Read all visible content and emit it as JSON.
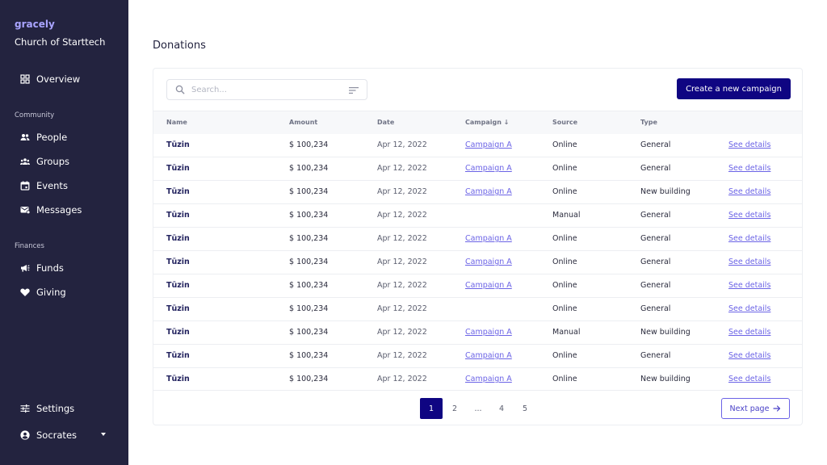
{
  "sidebar": {
    "brand": "gracely",
    "org": "Church of Starttech",
    "overview": {
      "label": "Overview",
      "icon": "grid-icon"
    },
    "community_label": "Community",
    "community": [
      {
        "label": "People",
        "icon": "people-icon"
      },
      {
        "label": "Groups",
        "icon": "groups-icon"
      },
      {
        "label": "Events",
        "icon": "calendar-icon"
      },
      {
        "label": "Messages",
        "icon": "messages-icon"
      }
    ],
    "finances_label": "Finances",
    "finances": [
      {
        "label": "Funds",
        "icon": "megaphone-icon"
      },
      {
        "label": "Giving",
        "icon": "heart-icon"
      }
    ],
    "settings": {
      "label": "Settings",
      "icon": "sliders-icon"
    },
    "user": {
      "label": "Socrates",
      "icon": "user-circle-icon"
    }
  },
  "page": {
    "title": "Donations"
  },
  "toolbar": {
    "search_placeholder": "Search...",
    "create_label": "Create a new campaign"
  },
  "table": {
    "headers": {
      "name": "Name",
      "amount": "Amount",
      "date": "Date",
      "campaign": "Campaign ↓",
      "source": "Source",
      "type": "Type"
    },
    "rows": [
      {
        "name": "Tūzin",
        "amount": "$ 100,234",
        "date": "Apr 12, 2022",
        "campaign": "Campaign A",
        "source": "Online",
        "type": "General",
        "details": "See details"
      },
      {
        "name": "Tūzin",
        "amount": "$ 100,234",
        "date": "Apr 12, 2022",
        "campaign": "Campaign A",
        "source": "Online",
        "type": "General",
        "details": "See details"
      },
      {
        "name": "Tūzin",
        "amount": "$ 100,234",
        "date": "Apr 12, 2022",
        "campaign": "Campaign A",
        "source": "Online",
        "type": "New building",
        "details": "See details"
      },
      {
        "name": "Tūzin",
        "amount": "$ 100,234",
        "date": "Apr 12, 2022",
        "campaign": "",
        "source": "Manual",
        "type": "General",
        "details": "See details"
      },
      {
        "name": "Tūzin",
        "amount": "$ 100,234",
        "date": "Apr 12, 2022",
        "campaign": "Campaign A",
        "source": "Online",
        "type": "General",
        "details": "See details"
      },
      {
        "name": "Tūzin",
        "amount": "$ 100,234",
        "date": "Apr 12, 2022",
        "campaign": "Campaign A",
        "source": "Online",
        "type": "General",
        "details": "See details"
      },
      {
        "name": "Tūzin",
        "amount": "$ 100,234",
        "date": "Apr 12, 2022",
        "campaign": "Campaign A",
        "source": "Online",
        "type": "General",
        "details": "See details"
      },
      {
        "name": "Tūzin",
        "amount": "$ 100,234",
        "date": "Apr 12, 2022",
        "campaign": "",
        "source": "Online",
        "type": "General",
        "details": "See details"
      },
      {
        "name": "Tūzin",
        "amount": "$ 100,234",
        "date": "Apr 12, 2022",
        "campaign": "Campaign A",
        "source": "Manual",
        "type": "New building",
        "details": "See details"
      },
      {
        "name": "Tūzin",
        "amount": "$ 100,234",
        "date": "Apr 12, 2022",
        "campaign": "Campaign A",
        "source": "Online",
        "type": "General",
        "details": "See details"
      },
      {
        "name": "Tūzin",
        "amount": "$ 100,234",
        "date": "Apr 12, 2022",
        "campaign": "Campaign A",
        "source": "Online",
        "type": "New building",
        "details": "See details"
      }
    ]
  },
  "pagination": {
    "pages": [
      "1",
      "2",
      "...",
      "4",
      "5"
    ],
    "current": "1",
    "next_label": "Next page"
  },
  "colors": {
    "sidebar_bg": "#23233f",
    "brand": "#a9a4ff",
    "primary": "#0f0582",
    "link": "#6b63e6"
  }
}
